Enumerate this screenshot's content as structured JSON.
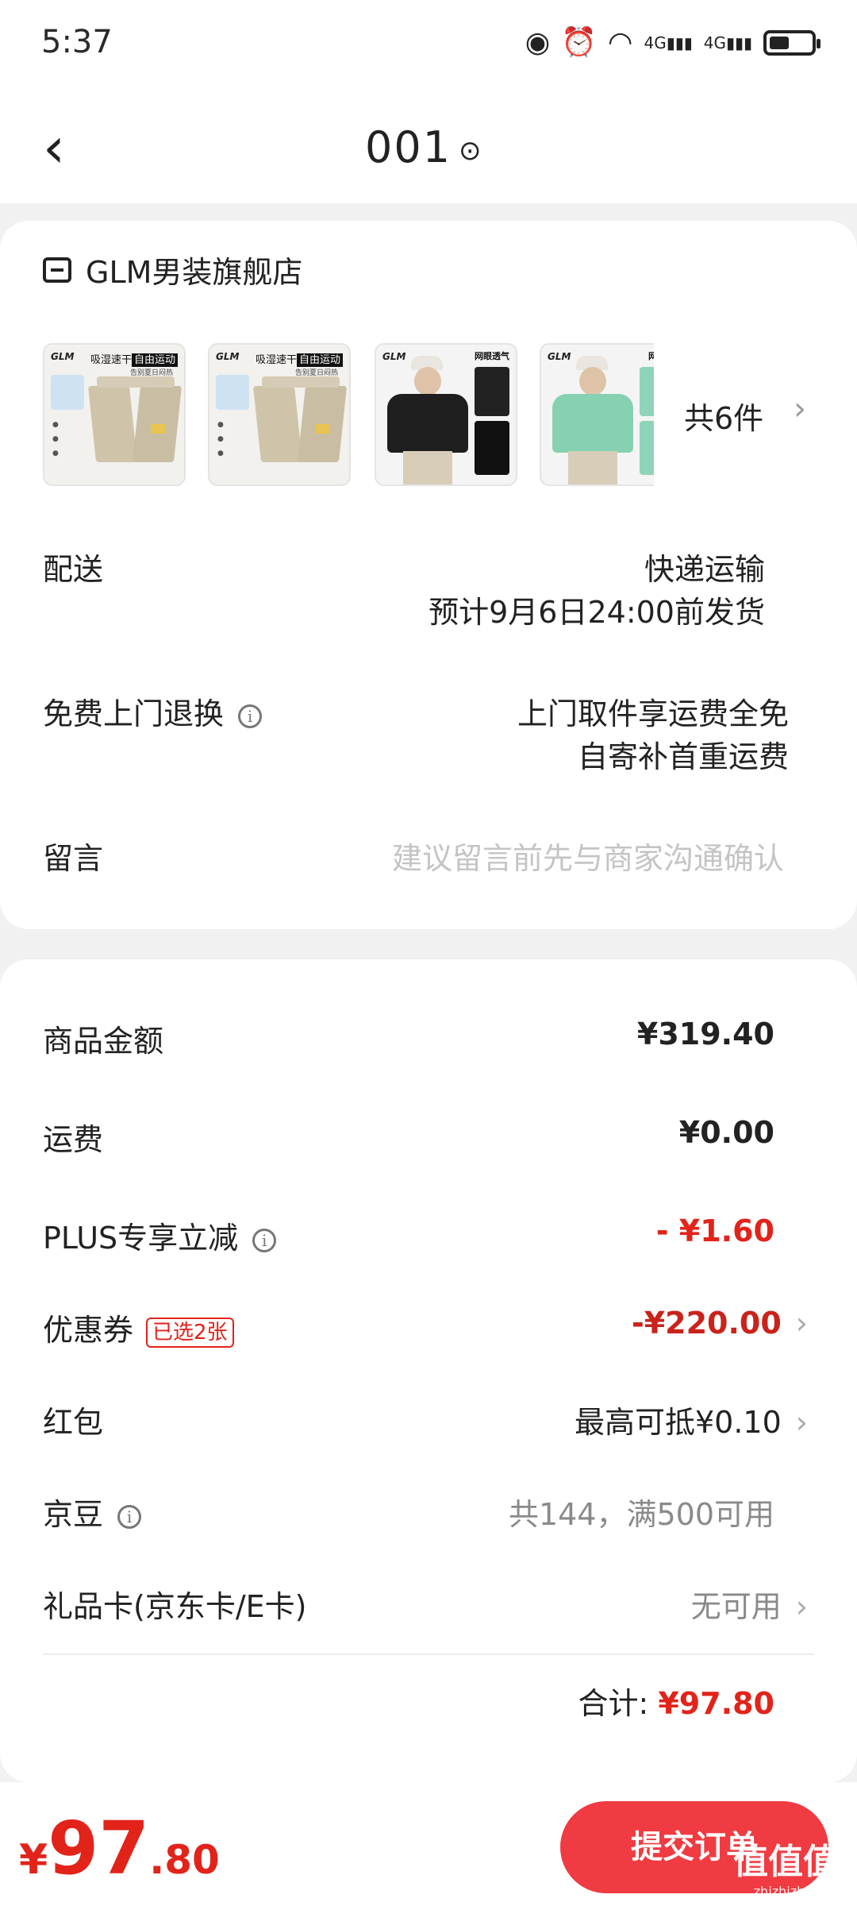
{
  "status_bar": {
    "time": "5:37",
    "icons": [
      "eye-icon",
      "alarm-icon",
      "wifi-icon",
      "signal-4g-icon",
      "signal-4g-icon",
      "battery-icon"
    ],
    "signal_label": "4G"
  },
  "nav": {
    "title": "001"
  },
  "order_card": {
    "shop_name": "GLM男装旗舰店",
    "thumbnails": [
      {
        "brand": "GLM",
        "tag_prefix": "吸湿速干",
        "tag_highlight": "自由运动",
        "sub": "告别夏日闷热"
      },
      {
        "brand": "GLM",
        "tag_prefix": "吸湿速干",
        "tag_highlight": "自由运动",
        "sub": "告别夏日闷热"
      },
      {
        "brand": "GLM",
        "tag": "网眼透气"
      },
      {
        "brand": "GLM",
        "tag": "网眼"
      }
    ],
    "items_count": "共6件",
    "delivery": {
      "label": "配送",
      "method": "快递运输",
      "eta": "预计9月6日24:00前发货"
    },
    "return": {
      "label": "免费上门退换",
      "line1": "上门取件享运费全免",
      "line2": "自寄补首重运费"
    },
    "message": {
      "label": "留言",
      "placeholder": "建议留言前先与商家沟通确认"
    }
  },
  "price_card": {
    "goods_amount": {
      "label": "商品金额",
      "value": "¥319.40"
    },
    "shipping": {
      "label": "运费",
      "value": "¥0.00"
    },
    "plus": {
      "label": "PLUS专享立减",
      "value": "- ¥1.60"
    },
    "coupon": {
      "label": "优惠券",
      "badge": "已选2张",
      "value": "-¥220.00"
    },
    "red_packet": {
      "label": "红包",
      "value": "最高可抵¥0.10"
    },
    "jingdou": {
      "label": "京豆",
      "value": "共144，满500可用"
    },
    "gift_card": {
      "label": "礼品卡(京东卡/E卡)",
      "value": "无可用"
    },
    "total": {
      "label": "合计:",
      "value": "¥97.80"
    }
  },
  "bottom_bar": {
    "price_symbol": "¥",
    "price_int": "97",
    "price_dec": ".80",
    "submit_label": "提交订单",
    "watermark": "值值值",
    "watermark_sub": "zhizhizhi.com"
  },
  "colors": {
    "accent": "#e2231a",
    "button": "#ef3b41",
    "page_bg": "#f1f1f1"
  }
}
